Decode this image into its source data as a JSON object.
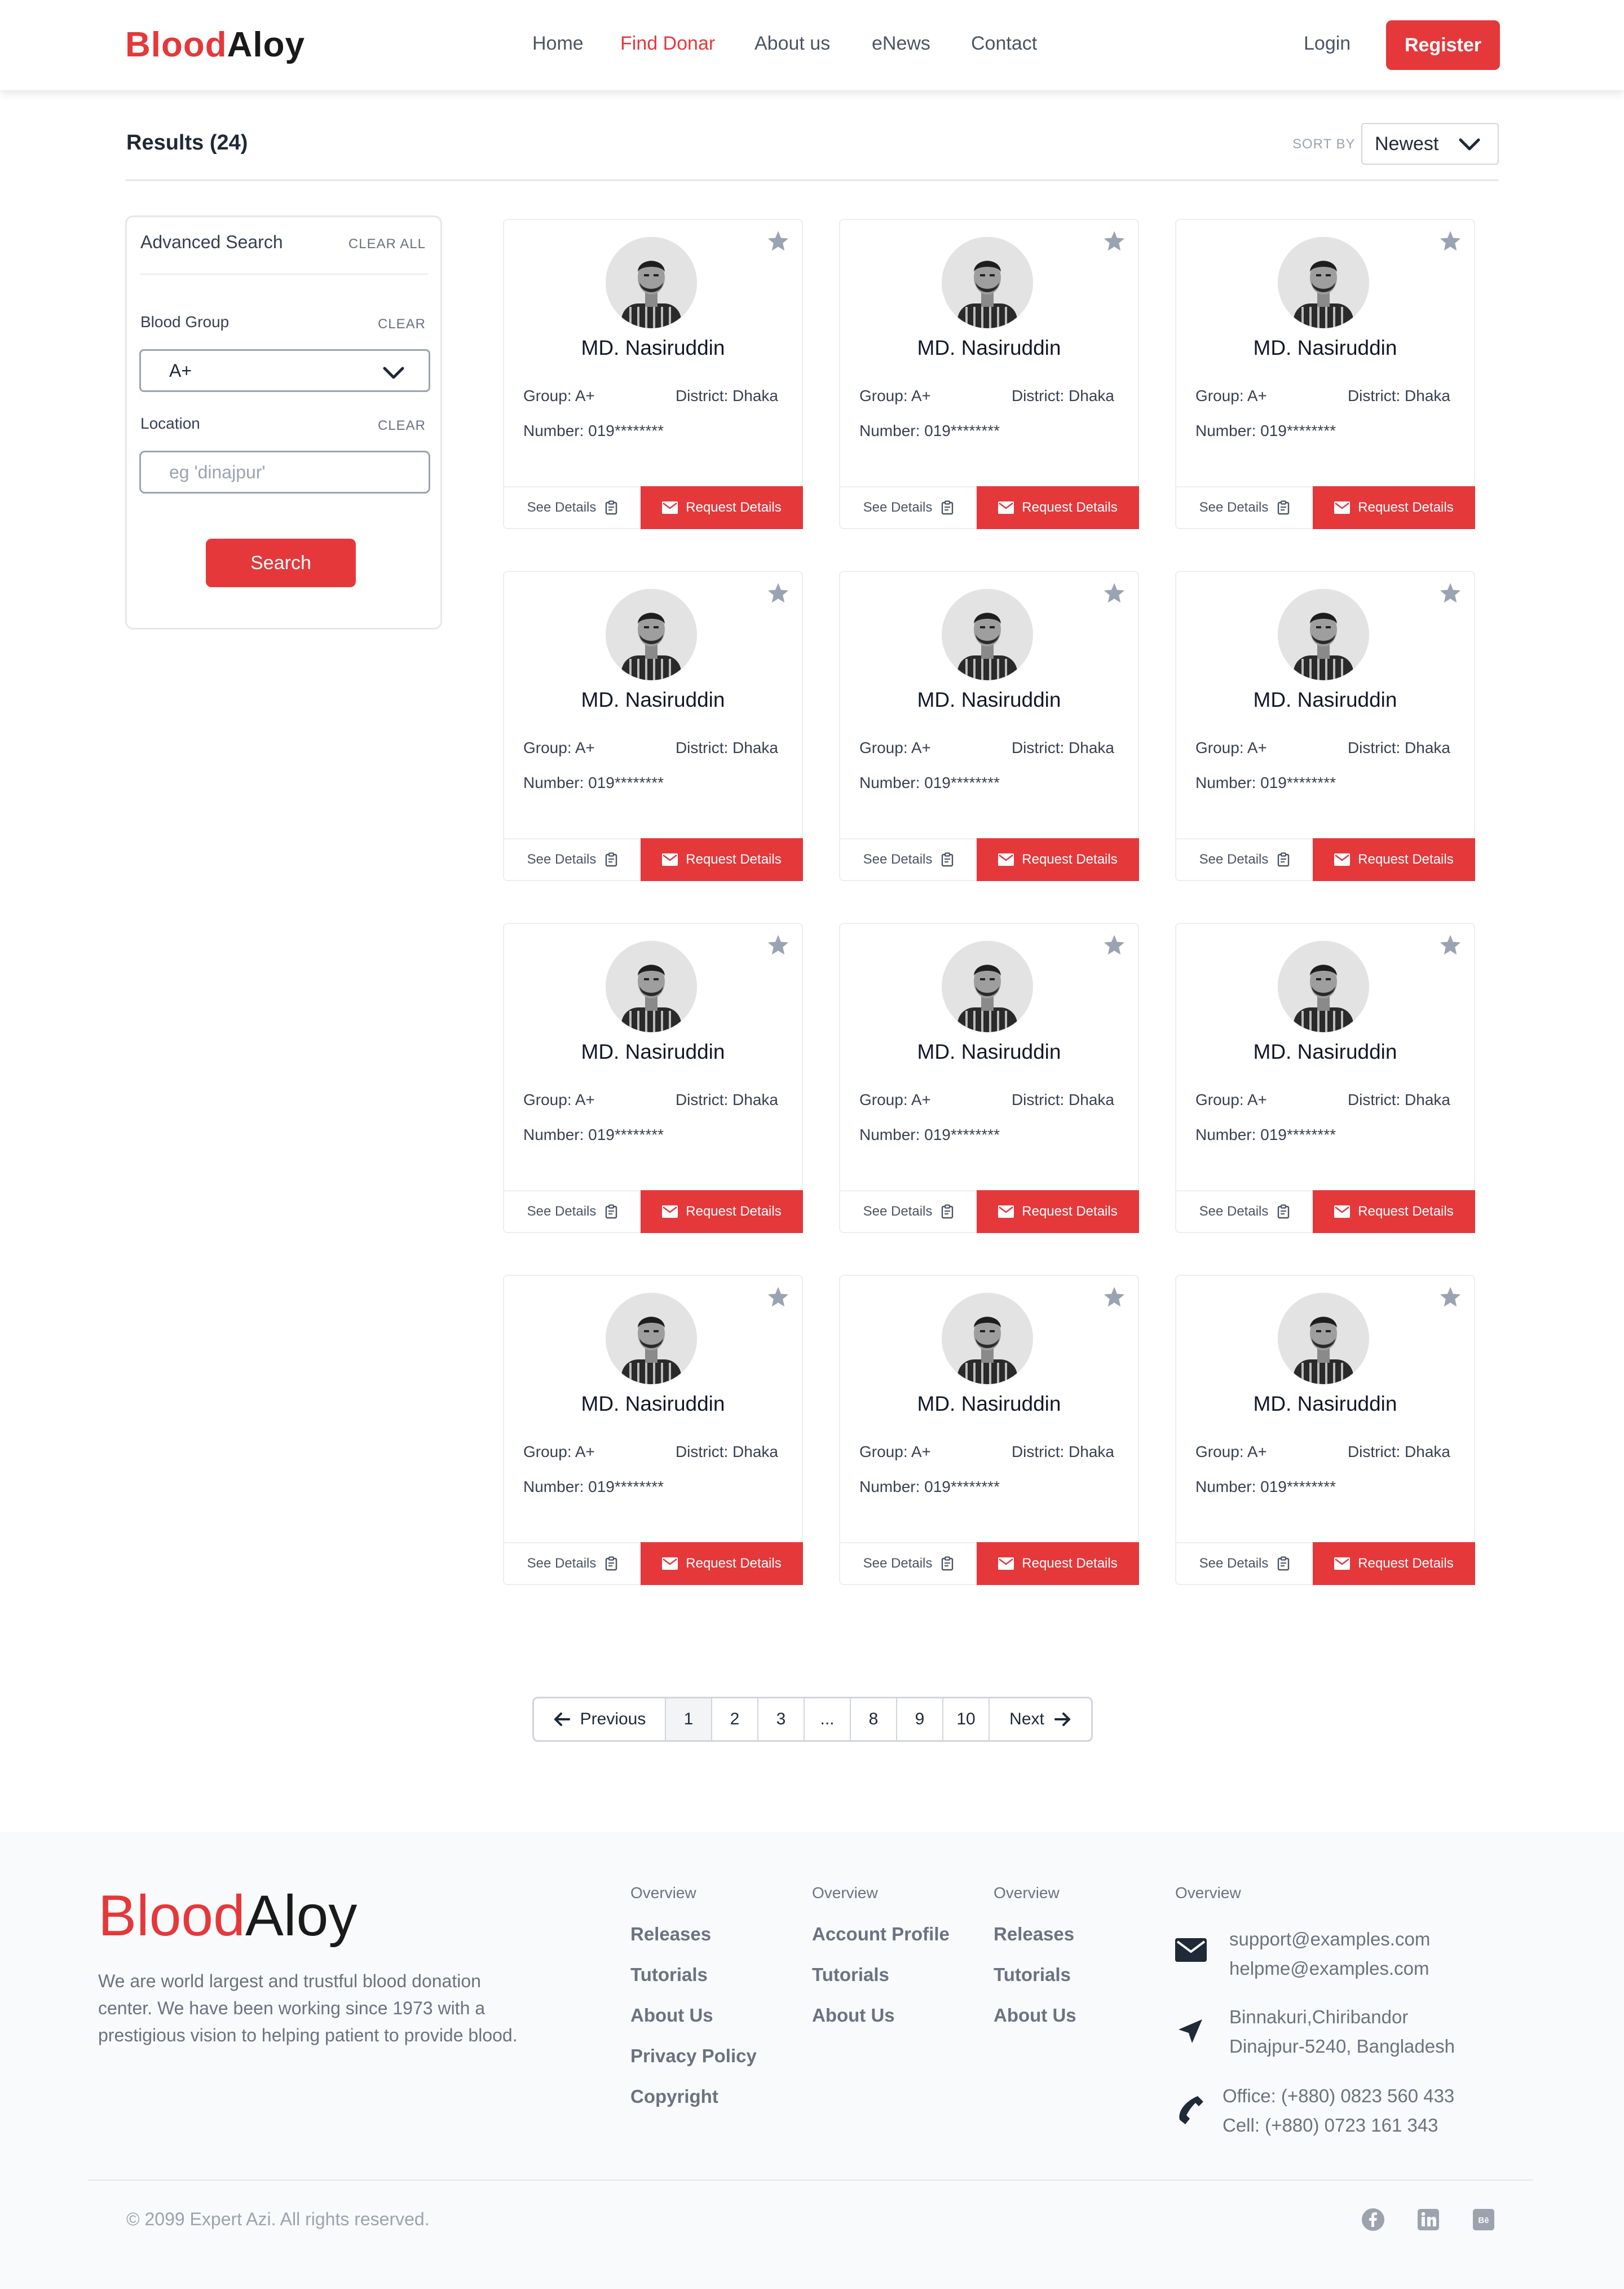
{
  "brand": {
    "part1": "Blood",
    "part2": "Aloy"
  },
  "nav": {
    "items": [
      "Home",
      "Find Donar",
      "About us",
      "eNews",
      "Contact"
    ],
    "active_index": 1
  },
  "auth": {
    "login": "Login",
    "register": "Register"
  },
  "results": {
    "title": "Results (24)",
    "sort_label": "SORT BY",
    "sort_value": "Newest"
  },
  "sidebar": {
    "title": "Advanced Search",
    "clear_all": "CLEAR ALL",
    "blood_group_label": "Blood Group",
    "blood_group_clear": "CLEAR",
    "blood_group_value": "A+",
    "location_label": "Location",
    "location_clear": "CLEAR",
    "location_placeholder": "eg 'dinajpur'",
    "search_button": "Search"
  },
  "donors": [
    {
      "name": "MD. Nasiruddin",
      "group": "Group: A+",
      "district": "District: Dhaka",
      "number": "Number: 019********",
      "see_details": "See Details",
      "request_details": "Request Details"
    },
    {
      "name": "MD. Nasiruddin",
      "group": "Group: A+",
      "district": "District: Dhaka",
      "number": "Number: 019********",
      "see_details": "See Details",
      "request_details": "Request Details"
    },
    {
      "name": "MD. Nasiruddin",
      "group": "Group: A+",
      "district": "District: Dhaka",
      "number": "Number: 019********",
      "see_details": "See Details",
      "request_details": "Request Details"
    },
    {
      "name": "MD. Nasiruddin",
      "group": "Group: A+",
      "district": "District: Dhaka",
      "number": "Number: 019********",
      "see_details": "See Details",
      "request_details": "Request Details"
    },
    {
      "name": "MD. Nasiruddin",
      "group": "Group: A+",
      "district": "District: Dhaka",
      "number": "Number: 019********",
      "see_details": "See Details",
      "request_details": "Request Details"
    },
    {
      "name": "MD. Nasiruddin",
      "group": "Group: A+",
      "district": "District: Dhaka",
      "number": "Number: 019********",
      "see_details": "See Details",
      "request_details": "Request Details"
    },
    {
      "name": "MD. Nasiruddin",
      "group": "Group: A+",
      "district": "District: Dhaka",
      "number": "Number: 019********",
      "see_details": "See Details",
      "request_details": "Request Details"
    },
    {
      "name": "MD. Nasiruddin",
      "group": "Group: A+",
      "district": "District: Dhaka",
      "number": "Number: 019********",
      "see_details": "See Details",
      "request_details": "Request Details"
    },
    {
      "name": "MD. Nasiruddin",
      "group": "Group: A+",
      "district": "District: Dhaka",
      "number": "Number: 019********",
      "see_details": "See Details",
      "request_details": "Request Details"
    },
    {
      "name": "MD. Nasiruddin",
      "group": "Group: A+",
      "district": "District: Dhaka",
      "number": "Number: 019********",
      "see_details": "See Details",
      "request_details": "Request Details"
    },
    {
      "name": "MD. Nasiruddin",
      "group": "Group: A+",
      "district": "District: Dhaka",
      "number": "Number: 019********",
      "see_details": "See Details",
      "request_details": "Request Details"
    },
    {
      "name": "MD. Nasiruddin",
      "group": "Group: A+",
      "district": "District: Dhaka",
      "number": "Number: 019********",
      "see_details": "See Details",
      "request_details": "Request Details"
    }
  ],
  "pagination": {
    "previous": "Previous",
    "next": "Next",
    "pages": [
      "1",
      "2",
      "3",
      "...",
      "8",
      "9",
      "10"
    ],
    "current": "1"
  },
  "footer": {
    "about": "We are world largest and trustful blood donation center. We have been working since 1973 with a prestigious vision to helping patient to provide blood.",
    "columns": [
      {
        "title": "Overview",
        "links": [
          "Releases",
          "Tutorials",
          "About Us",
          "Privacy Policy",
          "Copyright"
        ]
      },
      {
        "title": "Overview",
        "links": [
          "Account Profile",
          "Tutorials",
          "About Us"
        ]
      },
      {
        "title": "Overview",
        "links": [
          "Releases",
          "Tutorials",
          "About Us"
        ]
      }
    ],
    "contact": {
      "title": "Overview",
      "email1": "support@examples.com",
      "email2": "helpme@examples.com",
      "address1": "Binnakuri,Chiribandor",
      "address2": "Dinajpur-5240, Bangladesh",
      "office": "Office: (+880) 0823 560 433",
      "cell": "Cell: (+880) 0723 161 343"
    },
    "copyright": "© 2099 Expert Azi. All rights reserved.",
    "social_icons": [
      "facebook-icon",
      "linkedin-icon",
      "behance-icon"
    ]
  },
  "colors": {
    "accent": "#e5383b",
    "text": "#1f2937",
    "muted": "#6b7280",
    "star": "#9ca3af"
  }
}
